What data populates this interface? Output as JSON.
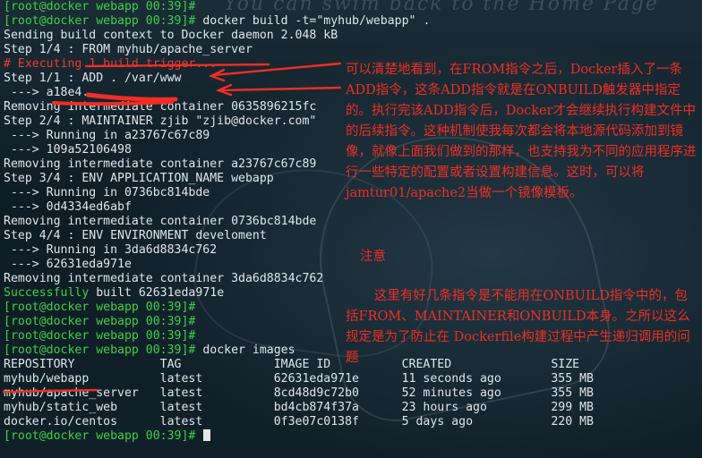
{
  "watermark": "You can swim back to the Home Page",
  "terminal": {
    "lines": [
      {
        "kind": "prompt",
        "prompt": "[root@docker webapp 00:39]#",
        "cmd": ""
      },
      {
        "kind": "prompt",
        "prompt": "[root@docker webapp 00:39]#",
        "cmd": " docker build -t=\"myhub/webapp\" ."
      },
      {
        "kind": "text",
        "text": "Sending build context to Docker daemon 2.048 kB"
      },
      {
        "kind": "text",
        "text": "Step 1/4 : FROM myhub/apache_server"
      },
      {
        "kind": "red",
        "text": "# Executing 1 build trigger..."
      },
      {
        "kind": "text",
        "text": "Step 1/1 : ADD . /var/www"
      },
      {
        "kind": "text",
        "text": " ---> a18e4..."
      },
      {
        "kind": "text",
        "text": "Removing intermediate container 0635896215fc"
      },
      {
        "kind": "text",
        "text": "Step 2/4 : MAINTAINER zjib \"zjib@docker.com\""
      },
      {
        "kind": "text",
        "text": " ---> Running in a23767c67c89"
      },
      {
        "kind": "text",
        "text": " ---> 109a52106498"
      },
      {
        "kind": "text",
        "text": "Removing intermediate container a23767c67c89"
      },
      {
        "kind": "text",
        "text": "Step 3/4 : ENV APPLICATION_NAME webapp"
      },
      {
        "kind": "text",
        "text": " ---> Running in 0736bc814bde"
      },
      {
        "kind": "text",
        "text": " ---> 0d4334ed6abf"
      },
      {
        "kind": "text",
        "text": "Removing intermediate container 0736bc814bde"
      },
      {
        "kind": "text",
        "text": "Step 4/4 : ENV ENVIRONMENT develoment"
      },
      {
        "kind": "text",
        "text": " ---> Running in 3da6d8834c762"
      },
      {
        "kind": "text",
        "text": " ---> 62631eda971e"
      },
      {
        "kind": "text",
        "text": "Removing intermediate container 3da6d8834c762"
      },
      {
        "kind": "success",
        "ok": "Successfully",
        "rest": " built 62631eda971e"
      },
      {
        "kind": "prompt",
        "prompt": "[root@docker webapp 00:39]#",
        "cmd": ""
      },
      {
        "kind": "prompt",
        "prompt": "[root@docker webapp 00:39]#",
        "cmd": ""
      },
      {
        "kind": "prompt",
        "prompt": "[root@docker webapp 00:39]#",
        "cmd": ""
      },
      {
        "kind": "prompt",
        "prompt": "[root@docker webapp 00:39]#",
        "cmd": " docker images"
      },
      {
        "kind": "text",
        "text": "REPOSITORY            TAG             IMAGE ID          CREATED              SIZE"
      },
      {
        "kind": "text",
        "text": "myhub/webapp          latest          62631eda971e      11 seconds ago       355 MB"
      },
      {
        "kind": "text",
        "text": "myhub/apache_server   latest          8cd48d9c72b0      52 minutes ago       355 MB"
      },
      {
        "kind": "text",
        "text": "myhub/static_web      latest          bd4cb874f37a      23 hours ago         299 MB"
      },
      {
        "kind": "text",
        "text": "docker.io/centos      latest          0f3e07c0138f      5 days ago           220 MB"
      },
      {
        "kind": "prompt",
        "prompt": "[root@docker webapp 00:39]#",
        "cmd": " ",
        "cursor": true
      }
    ]
  },
  "notes": {
    "n1": "可以清楚地看到，在FROM指令之后，Docker插入了一条ADD指令，这条ADD指令就是在ONBUILD触发器中指定的。执行完该ADD指令后，Docker才会继续执行构建文件中的后续指令。这种机制使我每次都会将本地源代码添加到镜像，就像上面我们做到的那样，也支持我为不同的应用程序进行一些特定的配置或者设置构建信息。这时，可以将jamtur01/apache2当做一个镜像模板。",
    "n2": "注意",
    "n3": "这里有好几条指令是不能用在ONBUILD指令中的，包括FROM、MAINTAINER和ONBUILD本身。之所以这么规定是为了防止在 Dockerfile构建过程中产生递归调用的问题"
  },
  "colors": {
    "prompt": "#3fd048",
    "annotation": "#f02e24",
    "text": "#dfe6ea"
  }
}
